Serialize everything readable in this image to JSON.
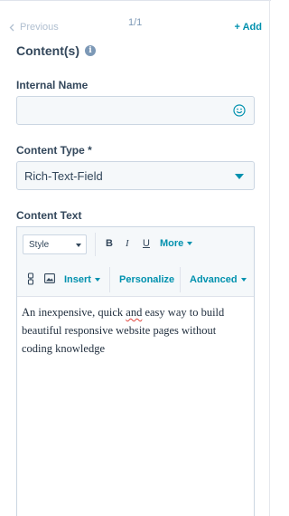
{
  "nav": {
    "previous_label": "Previous",
    "pager": "1/1",
    "add_label": "+ Add"
  },
  "section": {
    "title": "Content(s)",
    "info_glyph": "i"
  },
  "fields": {
    "internal_name": {
      "label": "Internal Name",
      "value": "",
      "icon": "emoji-icon"
    },
    "content_type": {
      "label": "Content Type *",
      "selected": "Rich-Text-Field"
    },
    "content_text": {
      "label": "Content Text"
    }
  },
  "editor": {
    "toolbar": {
      "style_label": "Style",
      "bold": "B",
      "italic": "I",
      "underline": "U",
      "more": "More",
      "insert": "Insert",
      "personalize": "Personalize",
      "advanced": "Advanced"
    },
    "content": {
      "before": "An inexpensive, quick ",
      "misspelled": "and",
      "after": " easy way to build beautiful responsive website pages without coding knowledge"
    }
  },
  "colors": {
    "accent": "#0091ae",
    "text": "#33475b",
    "muted": "#b0bfd0",
    "input_bg": "#f5f8fa",
    "border": "#cbd6e2"
  }
}
